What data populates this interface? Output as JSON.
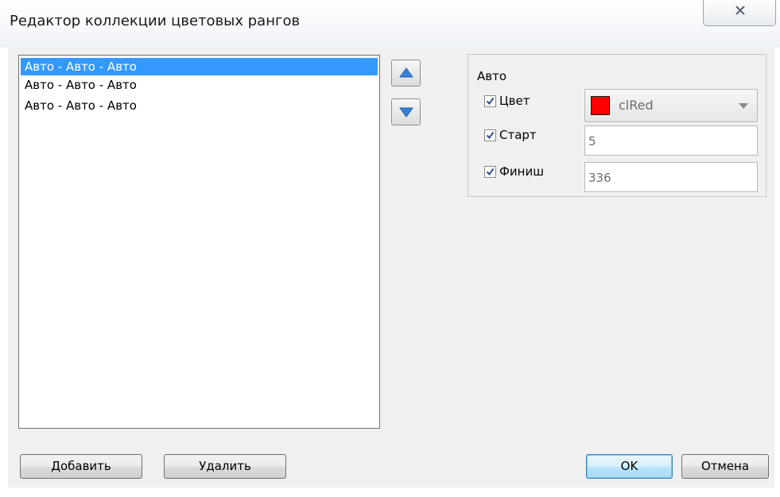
{
  "window": {
    "title": "Редактор коллекции цветовых рангов",
    "close_icon": "close-x-icon"
  },
  "list": {
    "items": [
      {
        "label": "Авто - Авто - Авто",
        "selected": true
      },
      {
        "label": "Авто - Авто - Авто",
        "selected": false
      },
      {
        "label": "Авто - Авто - Авто",
        "selected": false
      }
    ]
  },
  "move_buttons": {
    "up_icon": "arrow-up-icon",
    "down_icon": "arrow-down-icon"
  },
  "properties": {
    "group_title": "Авто",
    "color": {
      "label": "Цвет",
      "checked": true,
      "value": "clRed",
      "swatch": "#ff0000"
    },
    "start": {
      "label": "Старт",
      "checked": true,
      "value": "5"
    },
    "finish": {
      "label": "Финиш",
      "checked": true,
      "value": "336"
    }
  },
  "buttons": {
    "add": "Добавить",
    "delete": "Удалить",
    "ok": "OK",
    "cancel": "Отмена"
  },
  "colors": {
    "selection": "#3399ff",
    "accent_button": "#3c7fb1"
  }
}
